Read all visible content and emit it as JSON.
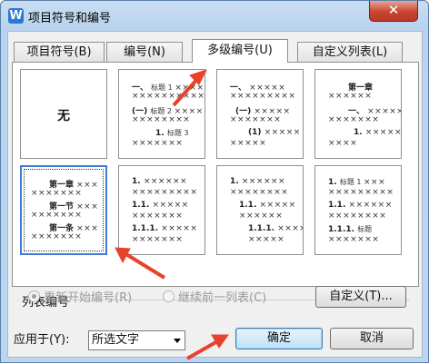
{
  "window": {
    "title": "项目符号和编号",
    "close_glyph": "✕",
    "app_icon": "W"
  },
  "tabs": [
    {
      "label": "项目符号(B)"
    },
    {
      "label": "编号(N)"
    },
    {
      "label": "多级编号(U)",
      "active": true
    },
    {
      "label": "自定义列表(L)"
    }
  ],
  "gallery": {
    "none_label": "无",
    "cells": [
      {
        "lines": []
      },
      {
        "lines": [
          {
            "lead": "一、",
            "label": "标题 1",
            "xs": "××××××"
          },
          {
            "lead": "",
            "label": "",
            "xs": "××××××××××"
          },
          {
            "lead": "(一)",
            "label": "标题 2",
            "xs": "×××××"
          },
          {
            "lead": "",
            "label": "",
            "xs": "××××××××"
          },
          {
            "lead": "1.",
            "label": "标题 3",
            "xs": ""
          },
          {
            "lead": "",
            "label": "",
            "xs": "×××××××"
          }
        ]
      },
      {
        "lines": [
          {
            "lead": "一、",
            "label": "",
            "xs": "×××××"
          },
          {
            "lead": "",
            "label": "",
            "xs": "×××××××××"
          },
          {
            "lead": "(一)",
            "label": "",
            "xs": "×××××"
          },
          {
            "lead": "",
            "label": "",
            "xs": "×××××××"
          },
          {
            "lead": "(1)",
            "label": "",
            "xs": "×××××"
          },
          {
            "lead": "",
            "label": "",
            "xs": "×××××"
          }
        ]
      },
      {
        "lines": [
          {
            "lead": "第一章",
            "label": "",
            "xs": ""
          },
          {
            "lead": "",
            "label": "",
            "xs": "××××××"
          },
          {
            "lead": "一、",
            "label": "",
            "xs": "×××××"
          },
          {
            "lead": "",
            "label": "",
            "xs": "×××××××"
          },
          {
            "lead": "1.",
            "label": "",
            "xs": "×××××"
          },
          {
            "lead": "",
            "label": "",
            "xs": "××××"
          }
        ]
      },
      {
        "lines": [
          {
            "lead": "第一章",
            "label": "",
            "xs": "×××"
          },
          {
            "lead": "",
            "label": "",
            "xs": "×××××××"
          },
          {
            "lead": "第一节",
            "label": "",
            "xs": "×××"
          },
          {
            "lead": "",
            "label": "",
            "xs": "×××××××"
          },
          {
            "lead": "第一条",
            "label": "",
            "xs": "×××"
          },
          {
            "lead": "",
            "label": "",
            "xs": "×××××××"
          }
        ]
      },
      {
        "lines": [
          {
            "lead": "1.",
            "label": "",
            "xs": "××××××"
          },
          {
            "lead": "",
            "label": "",
            "xs": "×××××××××"
          },
          {
            "lead": "1.1.",
            "label": "",
            "xs": "×××××"
          },
          {
            "lead": "",
            "label": "",
            "xs": "×××××××"
          },
          {
            "lead": "1.1.1.",
            "label": "",
            "xs": "×××××"
          },
          {
            "lead": "",
            "label": "",
            "xs": "×××××××"
          }
        ]
      },
      {
        "lines": [
          {
            "lead": "1.",
            "label": "",
            "xs": "××××××"
          },
          {
            "lead": "",
            "label": "",
            "xs": "××××××××"
          },
          {
            "lead": "1.1.",
            "label": "",
            "xs": "×××××"
          },
          {
            "lead": "",
            "label": "",
            "xs": "××××××"
          },
          {
            "lead": "1.1.1.",
            "label": "",
            "xs": "××××"
          },
          {
            "lead": "",
            "label": "",
            "xs": "×××××"
          }
        ]
      },
      {
        "lines": [
          {
            "lead": "1.",
            "label": "标题 1",
            "xs": "×××"
          },
          {
            "lead": "",
            "label": "",
            "xs": "×××××××××"
          },
          {
            "lead": "1.1.",
            "label": "",
            "xs": "××××××"
          },
          {
            "lead": "",
            "label": "",
            "xs": "××××××××"
          },
          {
            "lead": "1.1.1.",
            "label": "标题",
            "xs": ""
          },
          {
            "lead": "",
            "label": "",
            "xs": "×××××××"
          }
        ]
      }
    ]
  },
  "list_numbering": {
    "legend": "列表编号",
    "restart_label": "重新开始编号(R)",
    "continue_label": "继续前一列表(C)",
    "custom_button": "自定义(T)..."
  },
  "apply_to": {
    "label": "应用于(Y):",
    "selected": "所选文字"
  },
  "buttons": {
    "ok": "确定",
    "cancel": "取消"
  },
  "colors": {
    "annotation_arrow": "#e8422d",
    "selection_border": "#3d7bd8",
    "title_bar": "#bcd6f0"
  }
}
